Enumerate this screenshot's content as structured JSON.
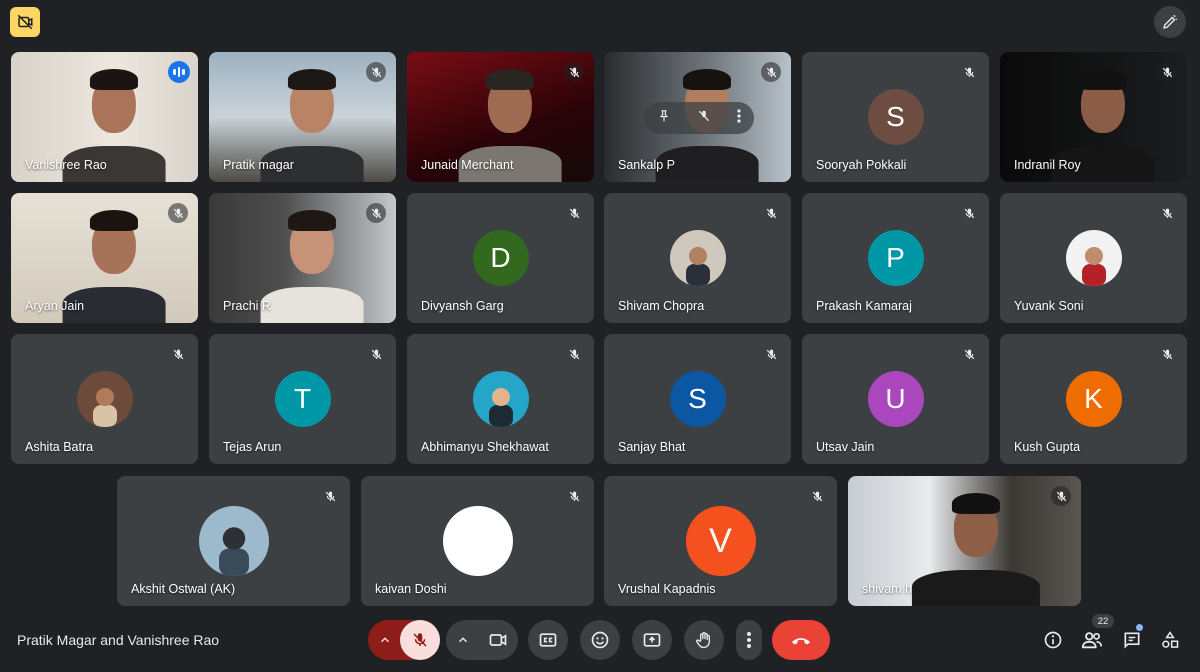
{
  "meeting": {
    "title": "Pratik Magar and Vanishree Rao"
  },
  "participant_count": "22",
  "colors": {
    "background": "#202124",
    "tile": "#3c4043",
    "speaking_outline": "#8ab4f8",
    "end_call": "#ea4335",
    "mic_off": "#f9dedc"
  },
  "tiles": [
    {
      "name": "Vanishree Rao",
      "type": "video",
      "speaking": true
    },
    {
      "name": "Pratik magar",
      "type": "video"
    },
    {
      "name": "Junaid Merchant",
      "type": "video"
    },
    {
      "name": "Sankalp P",
      "type": "video",
      "overlay_controls": true
    },
    {
      "name": "Sooryah Pokkali",
      "type": "initial",
      "initial": "S",
      "color": "#6d4c41"
    },
    {
      "name": "Indranil Roy",
      "type": "video"
    },
    {
      "name": "Aryan Jain",
      "type": "video"
    },
    {
      "name": "Prachi R",
      "type": "video"
    },
    {
      "name": "Divyansh Garg",
      "type": "initial",
      "initial": "D",
      "color": "#33691e"
    },
    {
      "name": "Shivam Chopra",
      "type": "photo"
    },
    {
      "name": "Prakash Kamaraj",
      "type": "initial",
      "initial": "P",
      "color": "#0097a7"
    },
    {
      "name": "Yuvank Soni",
      "type": "photo"
    },
    {
      "name": "Ashita Batra",
      "type": "photo"
    },
    {
      "name": "Tejas Arun",
      "type": "initial",
      "initial": "T",
      "color": "#0097a7"
    },
    {
      "name": "Abhimanyu Shekhawat",
      "type": "photo"
    },
    {
      "name": "Sanjay Bhat",
      "type": "initial",
      "initial": "S",
      "color": "#0b57a3"
    },
    {
      "name": "Utsav Jain",
      "type": "initial",
      "initial": "U",
      "color": "#ab47bc"
    },
    {
      "name": "Kush Gupta",
      "type": "initial",
      "initial": "K",
      "color": "#ef6c00"
    },
    {
      "name": "Akshit Ostwal (AK)",
      "type": "photo"
    },
    {
      "name": "kaivan Doshi",
      "type": "initial",
      "initial": "",
      "color": "#ffffff"
    },
    {
      "name": "Vrushal Kapadnis",
      "type": "initial",
      "initial": "V",
      "color": "#f4511e"
    },
    {
      "name": "shivam h",
      "type": "video"
    }
  ],
  "controls": {
    "mic_label": "Turn on microphone",
    "camera_label": "Turn on camera",
    "captions_label": "Turn on captions",
    "reactions_label": "Send a reaction",
    "present_label": "Present now",
    "raise_hand_label": "Raise hand",
    "more_label": "More options",
    "leave_label": "Leave call"
  },
  "icons": [
    "no-meeting-recording-icon",
    "pen-icon",
    "mic-off-icon",
    "audio-wave-icon",
    "chevron-up-icon",
    "camera-icon",
    "captions-icon",
    "emoji-icon",
    "present-icon",
    "hand-icon",
    "more-vert-icon",
    "end-call-icon",
    "info-icon",
    "people-icon",
    "chat-icon",
    "activities-icon",
    "pin-icon"
  ]
}
